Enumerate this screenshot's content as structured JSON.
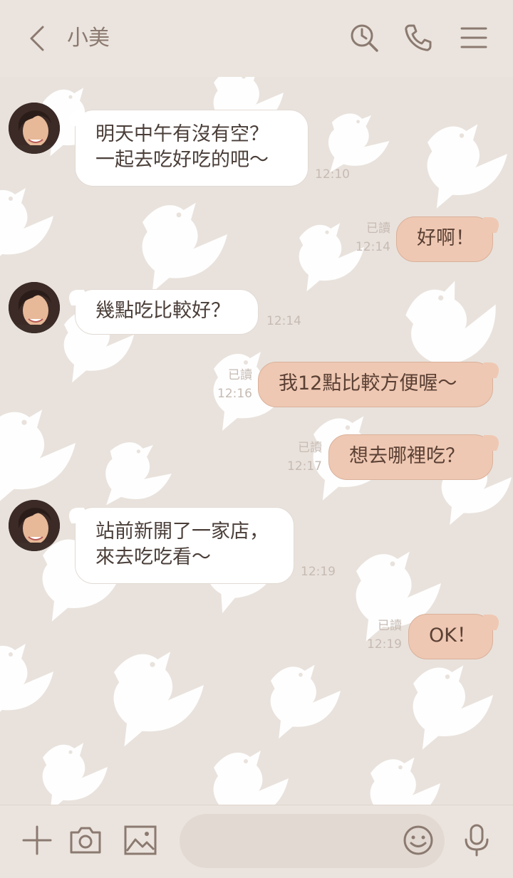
{
  "header": {
    "title": "小美",
    "icons": [
      "chevron-left-icon",
      "search-icon",
      "phone-icon",
      "menu-icon"
    ]
  },
  "messages": [
    {
      "side": "in",
      "lines": [
        "明天中午有沒有空？",
        "一起去吃好吃的吧～"
      ],
      "time": "12:10"
    },
    {
      "side": "out",
      "text": "好啊！",
      "read": "已讀",
      "time": "12:14"
    },
    {
      "side": "in",
      "text": "幾點吃比較好？",
      "time": "12:14"
    },
    {
      "side": "out",
      "text": "我12點比較方便喔～",
      "read": "已讀",
      "time": "12:16"
    },
    {
      "side": "out",
      "text": "想去哪裡吃？",
      "read": "已讀",
      "time": "12:17"
    },
    {
      "side": "in",
      "lines": [
        "站前新開了一家店，",
        "來去吃吃看～"
      ],
      "time": "12:19"
    },
    {
      "side": "out",
      "text": "OK！",
      "read": "已讀",
      "time": "12:19"
    }
  ],
  "footer": {
    "icons": [
      "plus-icon",
      "camera-icon",
      "image-icon",
      "emoji-icon",
      "microphone-icon"
    ],
    "input_placeholder": ""
  },
  "colors": {
    "header_bg": "#ebe4de",
    "chat_bg": "#e9e2dc",
    "incoming_bubble": "#ffffff",
    "outgoing_bubble": "#efc8b3",
    "icon": "#8b7a70"
  }
}
